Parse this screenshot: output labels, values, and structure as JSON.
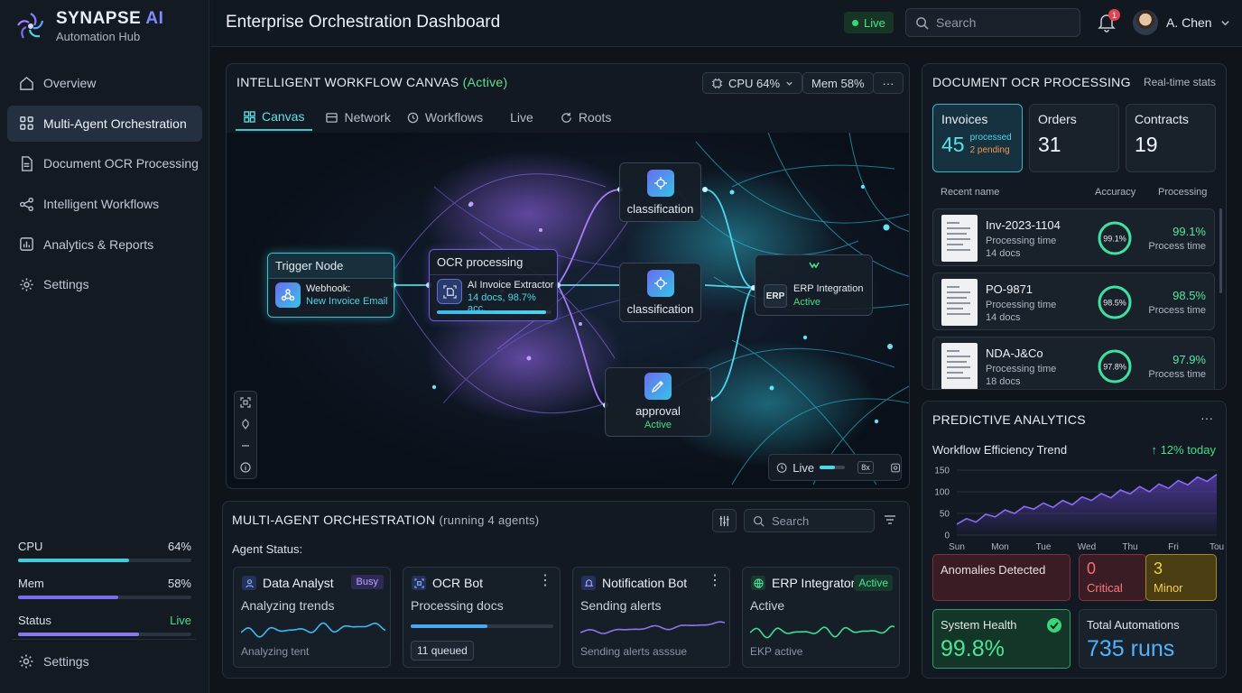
{
  "brand": {
    "name": "SYNAPSE",
    "name_accent": "AI",
    "subtitle": "Automation Hub"
  },
  "sidebar": {
    "items": [
      {
        "label": "Overview",
        "icon": "home-icon"
      },
      {
        "label": "Multi-Agent Orchestration",
        "icon": "grid-icon",
        "active": true
      },
      {
        "label": "Document OCR Processing",
        "icon": "document-icon"
      },
      {
        "label": "Intelligent Workflows",
        "icon": "share-icon"
      },
      {
        "label": "Analytics & Reports",
        "icon": "chart-icon"
      },
      {
        "label": "Settings",
        "icon": "gear-icon"
      }
    ],
    "system": {
      "cpu_label": "CPU",
      "cpu_value": "64%",
      "cpu_fill": 0.64,
      "mem_label": "Mem",
      "mem_value": "58%",
      "mem_fill": 0.58,
      "status_label": "Status",
      "status_value": "Live",
      "status_fill": 0.7
    },
    "settings_label": "Settings"
  },
  "header": {
    "title": "Enterprise Orchestration Dashboard",
    "live_label": "Live",
    "search_placeholder": "Search",
    "notification_count": "1",
    "user_name": "A. Chen"
  },
  "canvas": {
    "title": "INTELLIGENT WORKFLOW CANVAS",
    "state": "(Active)",
    "cpu_pill": "CPU 64%",
    "mem_pill": "Mem 58%",
    "more": "···",
    "tabs": [
      {
        "label": "Canvas",
        "icon": "grid-icon",
        "active": true
      },
      {
        "label": "Network",
        "icon": "network-icon"
      },
      {
        "label": "Workflows",
        "icon": "history-icon"
      },
      {
        "label": "Live",
        "icon": ""
      },
      {
        "label": "Roots",
        "icon": "refresh-icon"
      }
    ],
    "nodes": {
      "trigger": {
        "title": "Trigger Node",
        "line1": "Webhook:",
        "line2": "New Invoice Email"
      },
      "ocr": {
        "title": "OCR processing",
        "line1": "AI Invoice Extractor",
        "line2": "14 docs, 98.7% acc.",
        "progress": 0.95
      },
      "class1": {
        "label": "classification"
      },
      "class2": {
        "label": "classification"
      },
      "erp": {
        "tag": "ERP",
        "line1": "ERP Integration",
        "line2": "Active"
      },
      "approval": {
        "label": "approval",
        "status": "Active"
      }
    },
    "live_control": {
      "label": "Live",
      "speed": "8x",
      "level": 0.6
    }
  },
  "ocr_panel": {
    "title": "DOCUMENT OCR PROCESSING",
    "subtitle": "Real-time stats",
    "stats": [
      {
        "label": "Invoices",
        "value": "45",
        "note1": "processed",
        "note2": "2 pending"
      },
      {
        "label": "Orders",
        "value": "31"
      },
      {
        "label": "Contracts",
        "value": "19"
      }
    ],
    "columns": [
      "Recent name",
      "Accuracy",
      "Processing"
    ],
    "docs": [
      {
        "name": "Inv-2023-1104",
        "sub1": "Processing time",
        "sub2": "14 docs",
        "ring": "99.1%",
        "acc": 0.991,
        "pct": "99.1%",
        "pct_label": "Process time"
      },
      {
        "name": "PO-9871",
        "sub1": "Processing time",
        "sub2": "14 docs",
        "ring": "98.5%",
        "acc": 0.985,
        "pct": "98.5%",
        "pct_label": "Process time"
      },
      {
        "name": "NDA-J&Co",
        "sub1": "Processing time",
        "sub2": "18 docs",
        "ring": "97.8%",
        "acc": 0.978,
        "pct": "97.9%",
        "pct_label": "Process time"
      }
    ]
  },
  "predictive": {
    "title": "PREDICTIVE ANALYTICS",
    "more": "···",
    "chart_title": "Workflow Efficiency Trend",
    "trend": "↑ 12% today",
    "anomalies_label": "Anomalies Detected",
    "critical_value": "0",
    "critical_label": "Critical",
    "minor_value": "3",
    "minor_label": "Minor",
    "health_label": "System Health",
    "health_value": "99.8%",
    "automations_label": "Total Automations",
    "automations_value": "735 runs"
  },
  "chart_data": {
    "type": "area",
    "categories": [
      "Sun",
      "Mon",
      "Tue",
      "Wed",
      "Thu",
      "Fri",
      "Tou"
    ],
    "yticks": [
      0,
      50,
      100,
      150
    ],
    "ylim": [
      0,
      150
    ],
    "series": [
      {
        "values": [
          25,
          38,
          30,
          48,
          42,
          58,
          50,
          66,
          60,
          74,
          64,
          80,
          70,
          88,
          80,
          96,
          86,
          104,
          95,
          112,
          100,
          118,
          108,
          126,
          116,
          134,
          124,
          140
        ]
      }
    ],
    "colors": {
      "line": "#8a6cf4",
      "fill": "#5b3fb5"
    }
  },
  "agents": {
    "title": "MULTI-AGENT ORCHESTRATION",
    "running": "(running 4 agents)",
    "search_placeholder": "Search",
    "status_label": "Agent Status:",
    "cards": [
      {
        "name": "Data Analyst",
        "badge": "Busy",
        "activity": "Analyzing trends",
        "foot": "Analyzing tent",
        "color": "#3fb9f0"
      },
      {
        "name": "OCR Bot",
        "activity": "Processing docs",
        "foot": "11 queued",
        "progress": 0.54
      },
      {
        "name": "Notification Bot",
        "activity": "Sending alerts",
        "foot": "Sending alerts asssue",
        "color": "#8b74f0"
      },
      {
        "name": "ERP Integrator",
        "badge": "Active",
        "activity": "Active",
        "foot": "EKP active",
        "color": "#3fdc9a"
      }
    ]
  }
}
